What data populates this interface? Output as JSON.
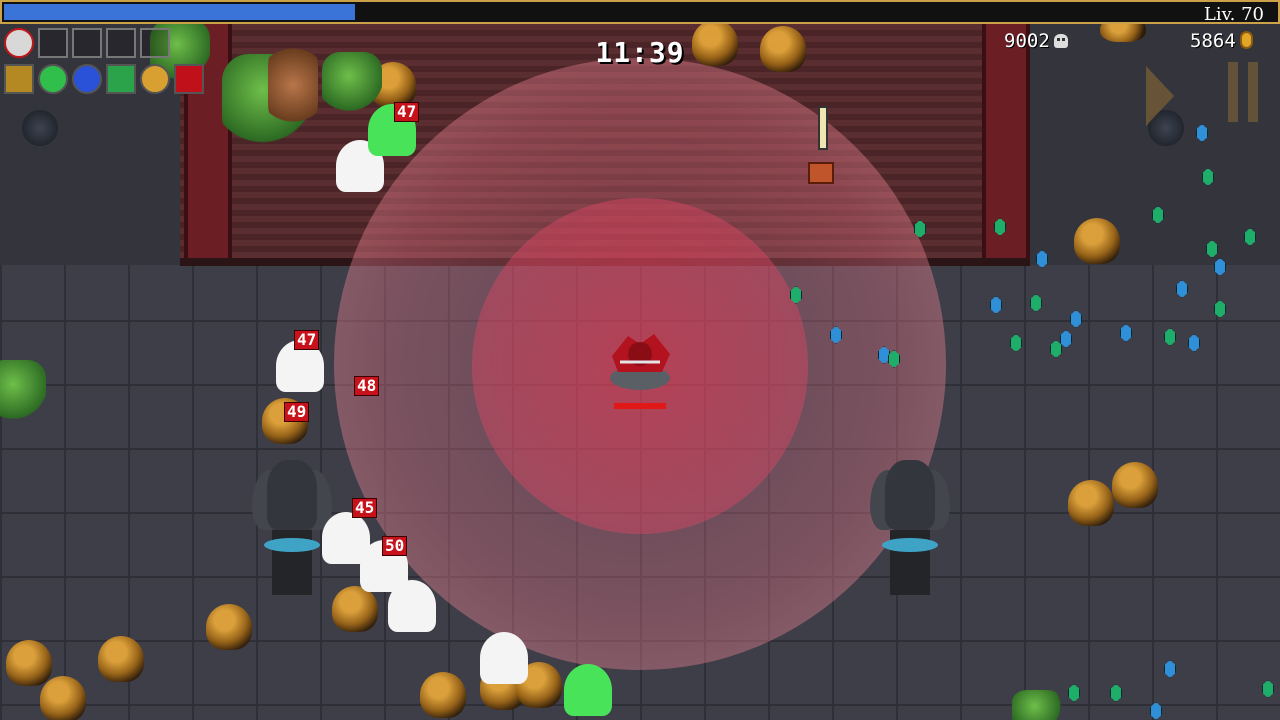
{
  "hud": {
    "level_label": "Liv. 70",
    "timer": "11:39",
    "kills": "9002",
    "gold": "5864",
    "xp_progress": 0.275
  },
  "colors": {
    "xp_fill": "#3a74d8",
    "aura": "#e05a75",
    "hp": "#e01818",
    "gem_blue": "#2f8fd8",
    "gem_green": "#1fae6a"
  },
  "icons": [
    "skull-icon",
    "coin-icon",
    "pause-icon",
    "play-icon",
    "treasure-chest-icon"
  ],
  "damage_numbers": [
    "47",
    "47",
    "48",
    "49",
    "45",
    "50",
    "45"
  ]
}
